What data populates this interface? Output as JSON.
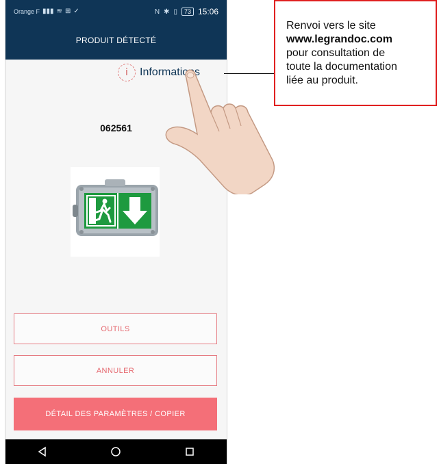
{
  "status_bar": {
    "carrier": "Orange F",
    "time": "15:06",
    "battery": "73"
  },
  "appbar": {
    "title": "PRODUIT DÉTECTÉ"
  },
  "content": {
    "info_label": "Informations",
    "product_code": "062561"
  },
  "buttons": {
    "outils": "OUTILS",
    "annuler": "ANNULER",
    "detail": "DÉTAIL DES PARAMÈTRES / COPIER"
  },
  "callout": {
    "line1": "Renvoi vers le site",
    "line2": "www.legrandoc.com",
    "line3": "pour consultation de",
    "line4": "toute la documentation",
    "line5": "liée au produit."
  },
  "colors": {
    "appbar": "#0f3556",
    "accent": "#f46f78",
    "callout_border": "#e02020"
  }
}
